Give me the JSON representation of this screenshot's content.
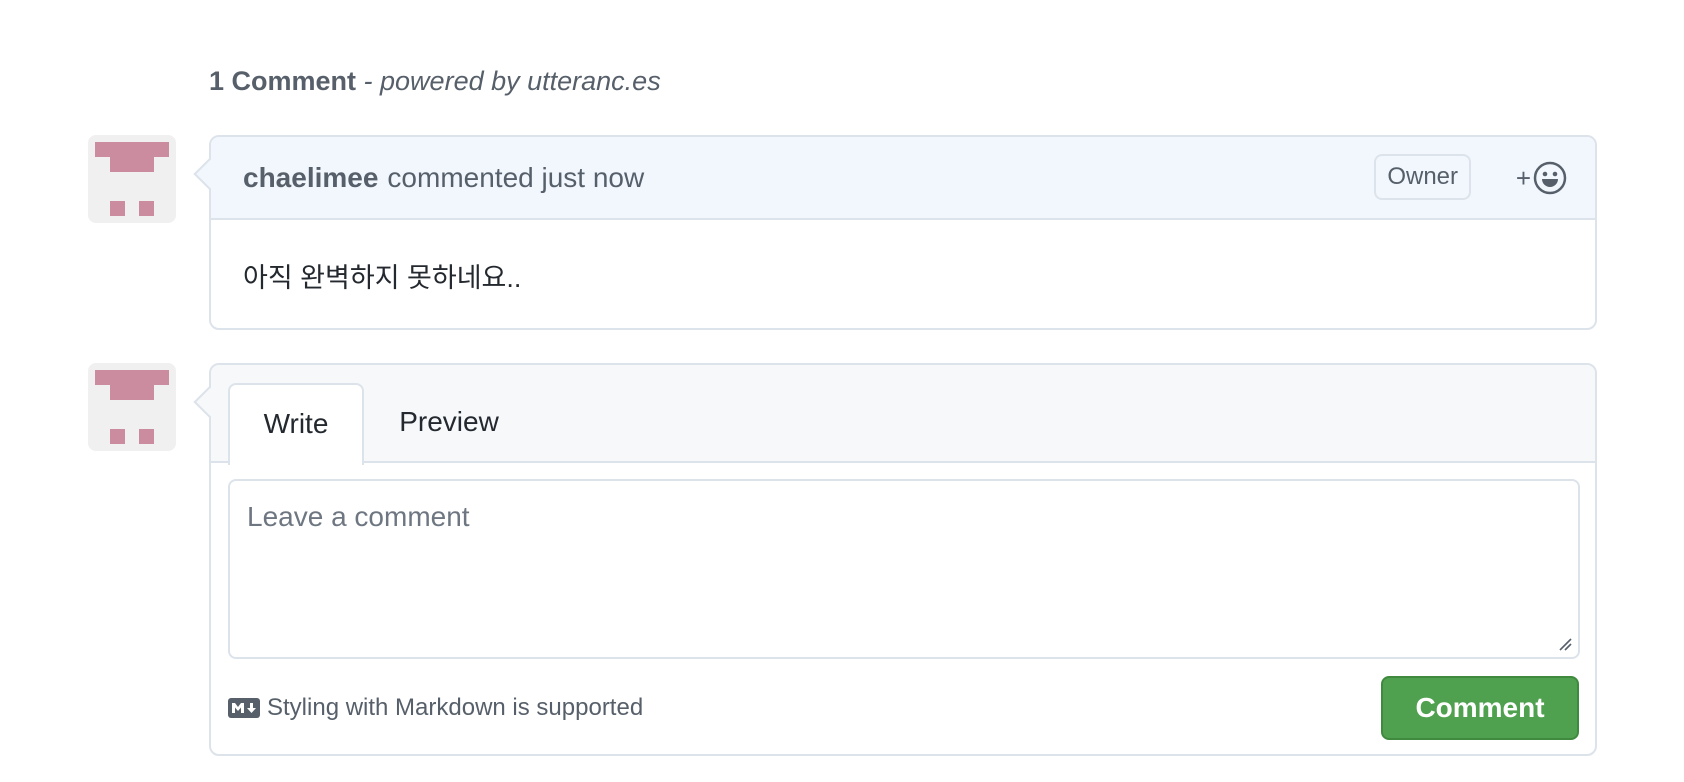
{
  "header": {
    "count": "1 Comment",
    "powered": " - powered by utteranc.es"
  },
  "comments": [
    {
      "author": "chaelimee",
      "action": "commented just now",
      "badge": "Owner",
      "reaction_icon": "plus-smiley-icon",
      "body": "아직 완벽하지 못하네요.."
    }
  ],
  "form": {
    "tabs": [
      "Write",
      "Preview"
    ],
    "placeholder": "Leave a comment",
    "markdown_note": "Styling with Markdown is supported",
    "submit_label": "Comment"
  },
  "colors": {
    "avatar_pink": "#cc8c9f",
    "header_bg": "#f1f7fd",
    "submit_green": "#4fa14f"
  }
}
